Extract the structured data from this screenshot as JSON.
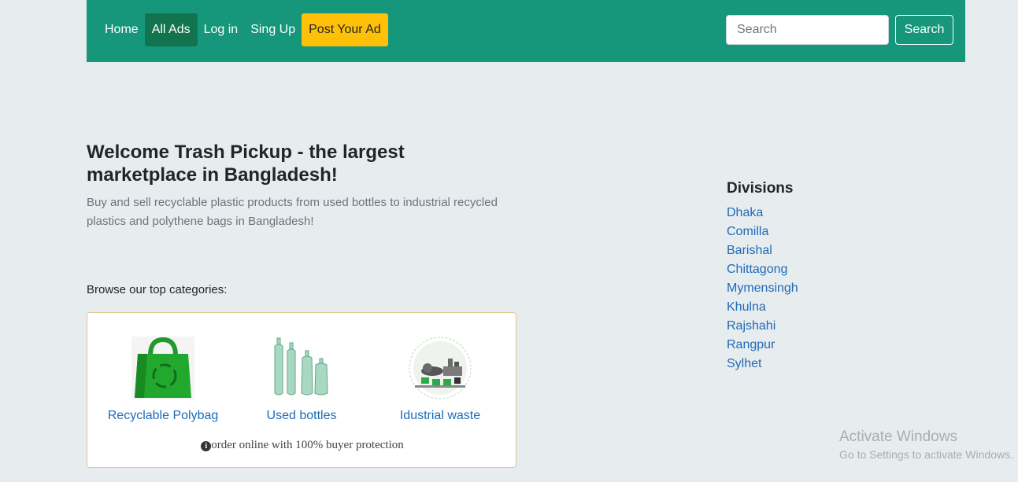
{
  "nav": {
    "items": [
      {
        "label": "Home"
      },
      {
        "label": "All Ads"
      },
      {
        "label": "Log in"
      },
      {
        "label": "Sing Up"
      },
      {
        "label": "Post Your Ad"
      }
    ],
    "search_placeholder": "Search",
    "search_button": "Search",
    "brand_color": "#16967a",
    "active_color": "#12734f",
    "post_color": "#ffc107"
  },
  "hero": {
    "title": "Welcome Trash Pickup - the largest marketplace in Bangladesh!",
    "subtitle": "Buy and sell recyclable plastic products from used bottles to industrial recycled plastics and polythene bags in Bangladesh!"
  },
  "categories": {
    "heading": "Browse our top categories:",
    "items": [
      {
        "label": "Recyclable Polybag",
        "icon": "green-bag-icon"
      },
      {
        "label": "Used bottles",
        "icon": "plastic-bottles-icon"
      },
      {
        "label": "Idustrial waste",
        "icon": "industrial-waste-icon"
      }
    ],
    "note": "order online with 100% buyer protection"
  },
  "divisions": {
    "title": "Divisions",
    "items": [
      "Dhaka",
      "Comilla",
      "Barishal",
      "Chittagong",
      "Mymensingh",
      "Khulna",
      "Rajshahi",
      "Rangpur",
      "Sylhet"
    ]
  },
  "watermark": {
    "title": "Activate Windows",
    "subtitle": "Go to Settings to activate Windows."
  }
}
